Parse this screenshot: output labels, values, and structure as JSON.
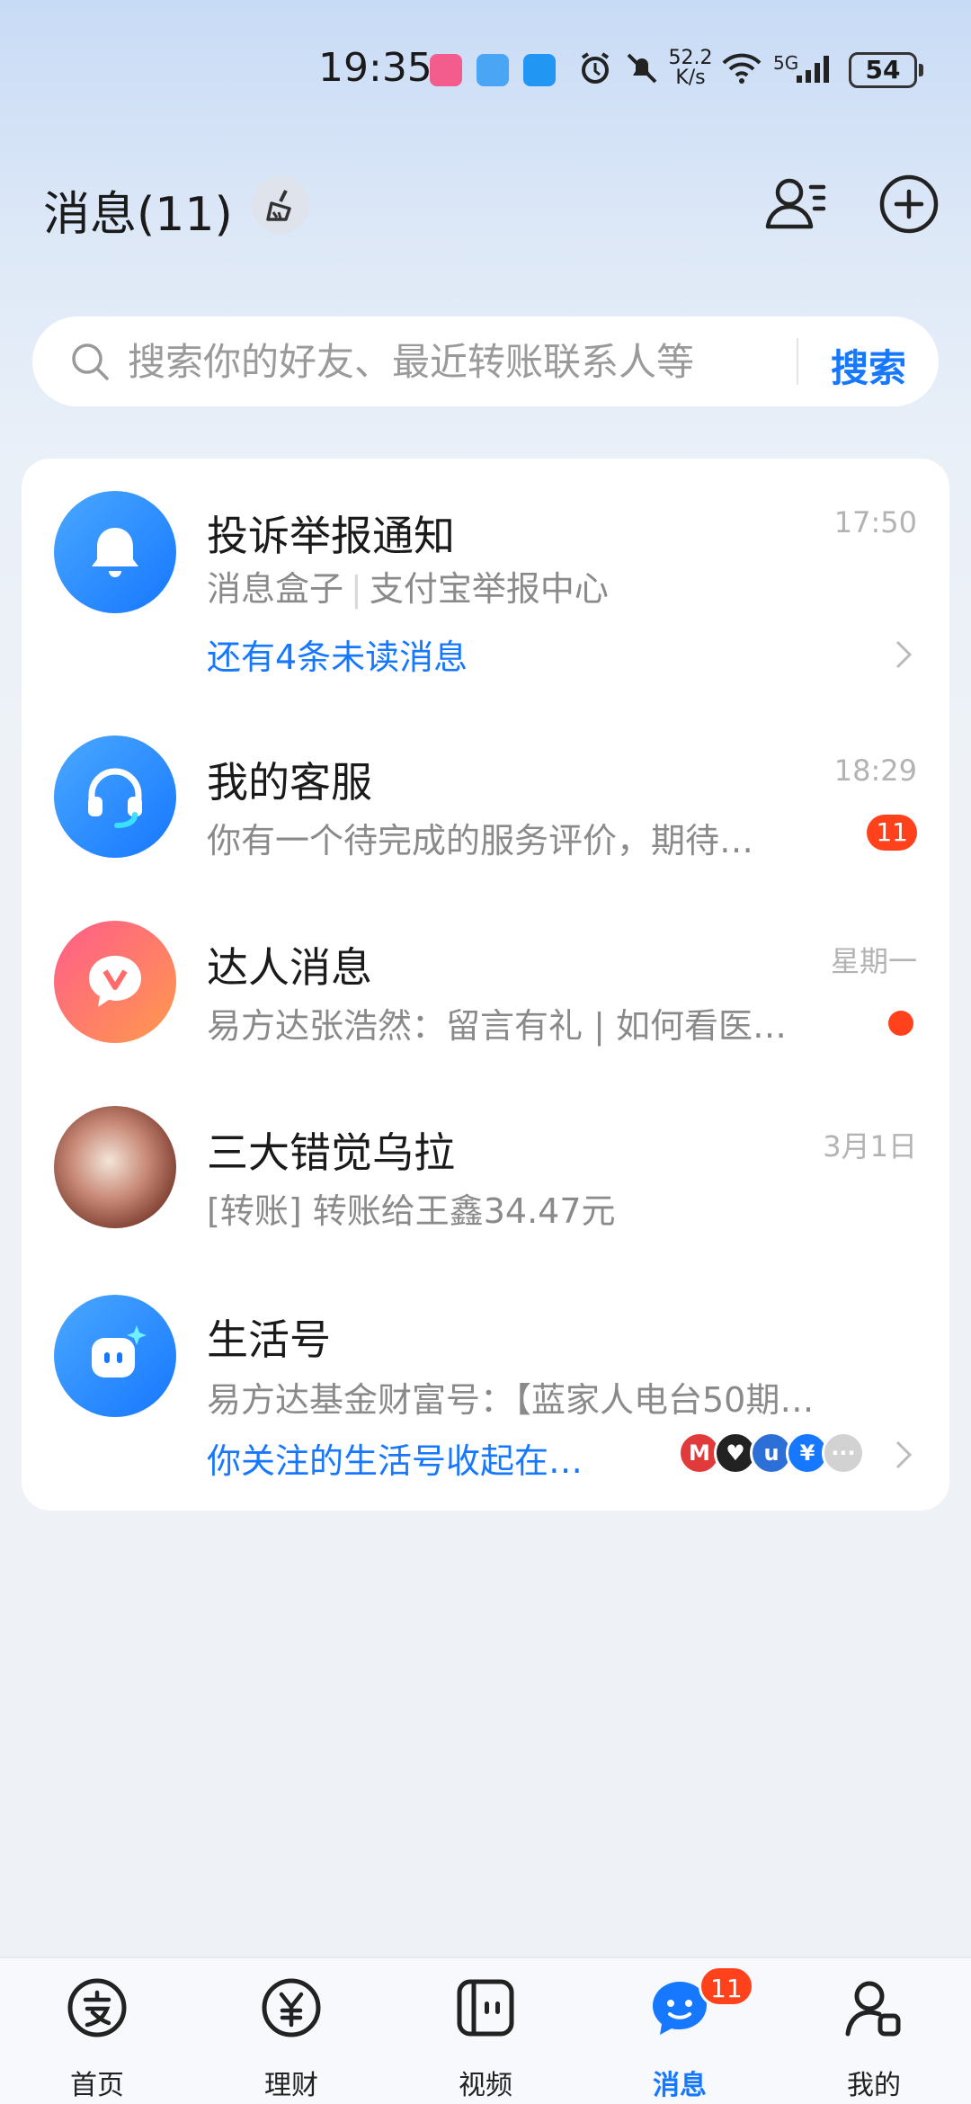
{
  "status_bar": {
    "time": "19:35",
    "net_speed_value": "52.2",
    "net_speed_unit": "K/s",
    "network": "5G",
    "battery": "54"
  },
  "header": {
    "title": "消息(11)"
  },
  "search": {
    "placeholder": "搜索你的好友、最近转账联系人等",
    "button_label": "搜索"
  },
  "messages": [
    {
      "title": "投诉举报通知",
      "subtitle_prefix": "消息盒子",
      "subtitle_source": "支付宝举报中心",
      "link": "还有4条未读消息",
      "time": "17:50",
      "avatar_icon": "bell-icon"
    },
    {
      "title": "我的客服",
      "subtitle": "你有一个待完成的服务评价，期待…",
      "time": "18:29",
      "badge": "11",
      "avatar_icon": "headset-icon"
    },
    {
      "title": "达人消息",
      "subtitle": "易方达张浩然：留言有礼 | 如何看医…",
      "time": "星期一",
      "avatar_icon": "v-chat-icon"
    },
    {
      "title": "三大错觉乌拉",
      "subtitle": "[转账] 转账给王鑫34.47元",
      "time": "3月1日",
      "avatar_icon": "user-photo"
    },
    {
      "title": "生活号",
      "subtitle": "易方达基金财富号：【蓝家人电台50期…",
      "link": "你关注的生活号收起在…",
      "avatar_icon": "life-account-icon"
    }
  ],
  "bottom_nav": [
    {
      "label": "首页",
      "icon": "alipay-home-icon"
    },
    {
      "label": "理财",
      "icon": "yuan-icon"
    },
    {
      "label": "视频",
      "icon": "video-icon"
    },
    {
      "label": "消息",
      "icon": "message-icon",
      "badge": "11",
      "active": true
    },
    {
      "label": "我的",
      "icon": "profile-icon"
    }
  ],
  "colors": {
    "accent": "#1677ff",
    "badge": "#ff411c"
  }
}
